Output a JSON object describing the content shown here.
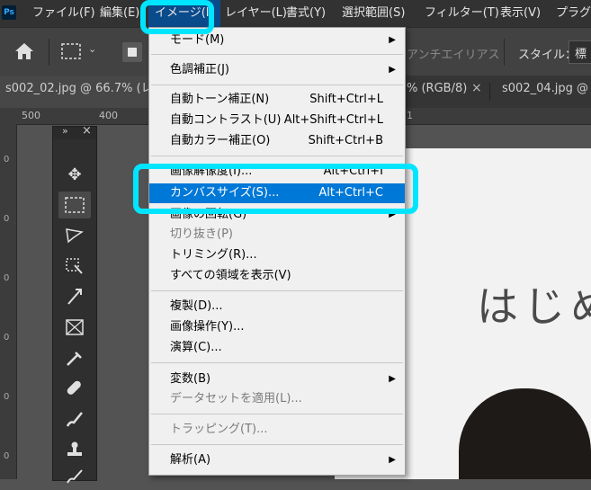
{
  "menubar": {
    "logo": "Ps",
    "items": [
      "ファイル(F)",
      "編集(E)",
      "イメージ(I)",
      "レイヤー(L)",
      "書式(Y)",
      "選択範囲(S)",
      "フィルター(T)",
      "表示(V)",
      "プラグイ"
    ]
  },
  "options": {
    "antialias": "アンチエイリアス",
    "style_label": "スタイル：",
    "style_value": "標"
  },
  "tabs": [
    "s002_02.jpg @ 66.7% (レ",
    "% (RGB/8)",
    "s002_04.jpg @"
  ],
  "ruler": {
    "top": [
      "500",
      "400",
      "1"
    ],
    "left": [
      "0",
      "0",
      "0",
      "0",
      "0",
      "0"
    ]
  },
  "document": {
    "text": "はじめ"
  },
  "image_menu": {
    "items": [
      {
        "label": "モード(M)",
        "shortcut": "",
        "submenu": true,
        "disabled": false
      },
      {
        "label": "色調補正(J)",
        "shortcut": "",
        "submenu": true,
        "disabled": false
      },
      {
        "label": "自動トーン補正(N)",
        "shortcut": "Shift+Ctrl+L",
        "submenu": false,
        "disabled": false
      },
      {
        "label": "自動コントラスト(U)",
        "shortcut": "Alt+Shift+Ctrl+L",
        "submenu": false,
        "disabled": false
      },
      {
        "label": "自動カラー補正(O)",
        "shortcut": "Shift+Ctrl+B",
        "submenu": false,
        "disabled": false
      },
      {
        "label": "画像解像度(I)...",
        "shortcut": "Alt+Ctrl+I",
        "submenu": false,
        "disabled": false
      },
      {
        "label": "カンバスサイズ(S)...",
        "shortcut": "Alt+Ctrl+C",
        "submenu": false,
        "disabled": false,
        "selected": true
      },
      {
        "label": "画像の回転(G)",
        "shortcut": "",
        "submenu": true,
        "disabled": false
      },
      {
        "label": "切り抜き(P)",
        "shortcut": "",
        "submenu": false,
        "disabled": true
      },
      {
        "label": "トリミング(R)...",
        "shortcut": "",
        "submenu": false,
        "disabled": false
      },
      {
        "label": "すべての領域を表示(V)",
        "shortcut": "",
        "submenu": false,
        "disabled": false
      },
      {
        "label": "複製(D)...",
        "shortcut": "",
        "submenu": false,
        "disabled": false
      },
      {
        "label": "画像操作(Y)...",
        "shortcut": "",
        "submenu": false,
        "disabled": false
      },
      {
        "label": "演算(C)...",
        "shortcut": "",
        "submenu": false,
        "disabled": false
      },
      {
        "label": "変数(B)",
        "shortcut": "",
        "submenu": true,
        "disabled": false
      },
      {
        "label": "データセットを適用(L)...",
        "shortcut": "",
        "submenu": false,
        "disabled": true
      },
      {
        "label": "トラッピング(T)...",
        "shortcut": "",
        "submenu": false,
        "disabled": true
      },
      {
        "label": "解析(A)",
        "shortcut": "",
        "submenu": true,
        "disabled": false
      }
    ]
  },
  "colors": {
    "highlight": "#00e5ff",
    "selection": "#0078d7"
  }
}
